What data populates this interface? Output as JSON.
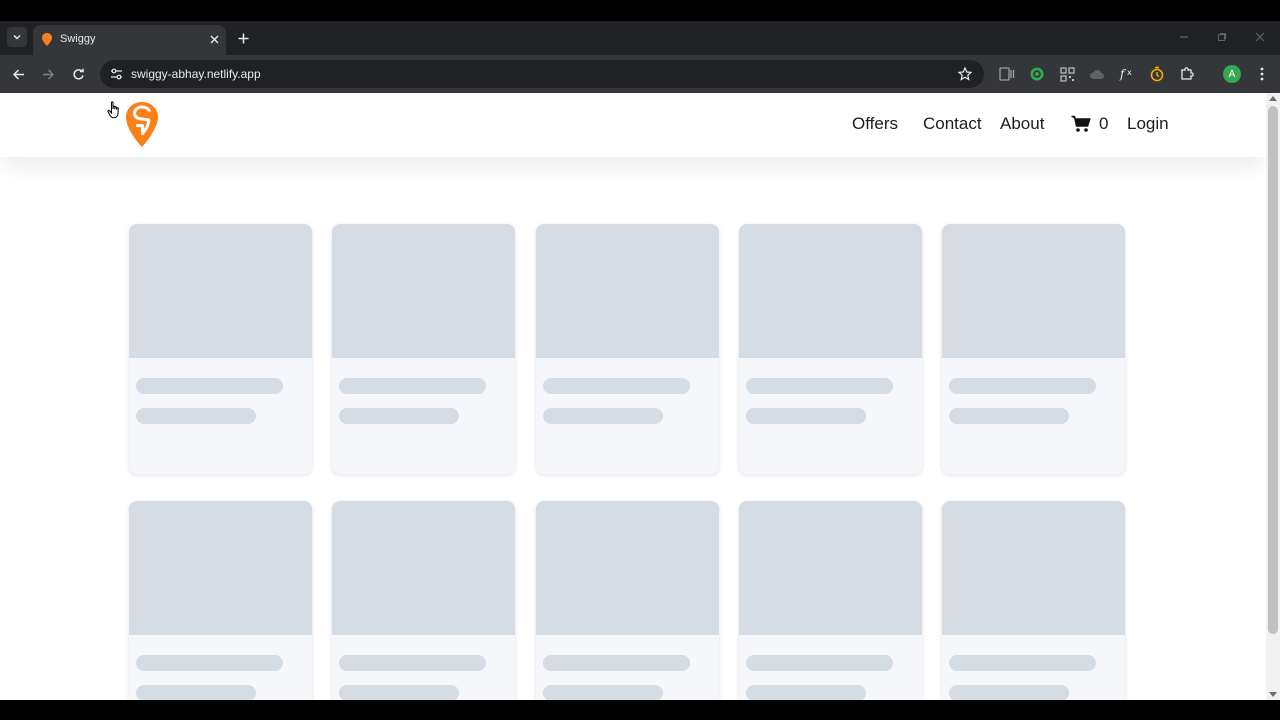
{
  "browser": {
    "tab": {
      "title": "Swiggy",
      "favicon": "swiggy-pin-icon"
    },
    "url": "swiggy-abhay.netlify.app",
    "profile_initial": "A",
    "extensions": [
      "css-icon",
      "target-icon",
      "qr-icon",
      "cloud-icon",
      "function-icon",
      "timer-icon",
      "puzzle-icon"
    ]
  },
  "header": {
    "brand_color": "#fc8019",
    "nav": {
      "offers": "Offers",
      "contact": "Contact",
      "about": "About",
      "login": "Login"
    },
    "cart_count": "0"
  },
  "content": {
    "state": "loading-skeleton",
    "skeleton_color": "#d6dce4",
    "card_background": "#f5f7fa",
    "rows": [
      {
        "cards": [
          "shimmer-card",
          "shimmer-card",
          "shimmer-card",
          "shimmer-card",
          "shimmer-card"
        ]
      },
      {
        "cards": [
          "shimmer-card",
          "shimmer-card",
          "shimmer-card",
          "shimmer-card",
          "shimmer-card"
        ]
      }
    ]
  }
}
